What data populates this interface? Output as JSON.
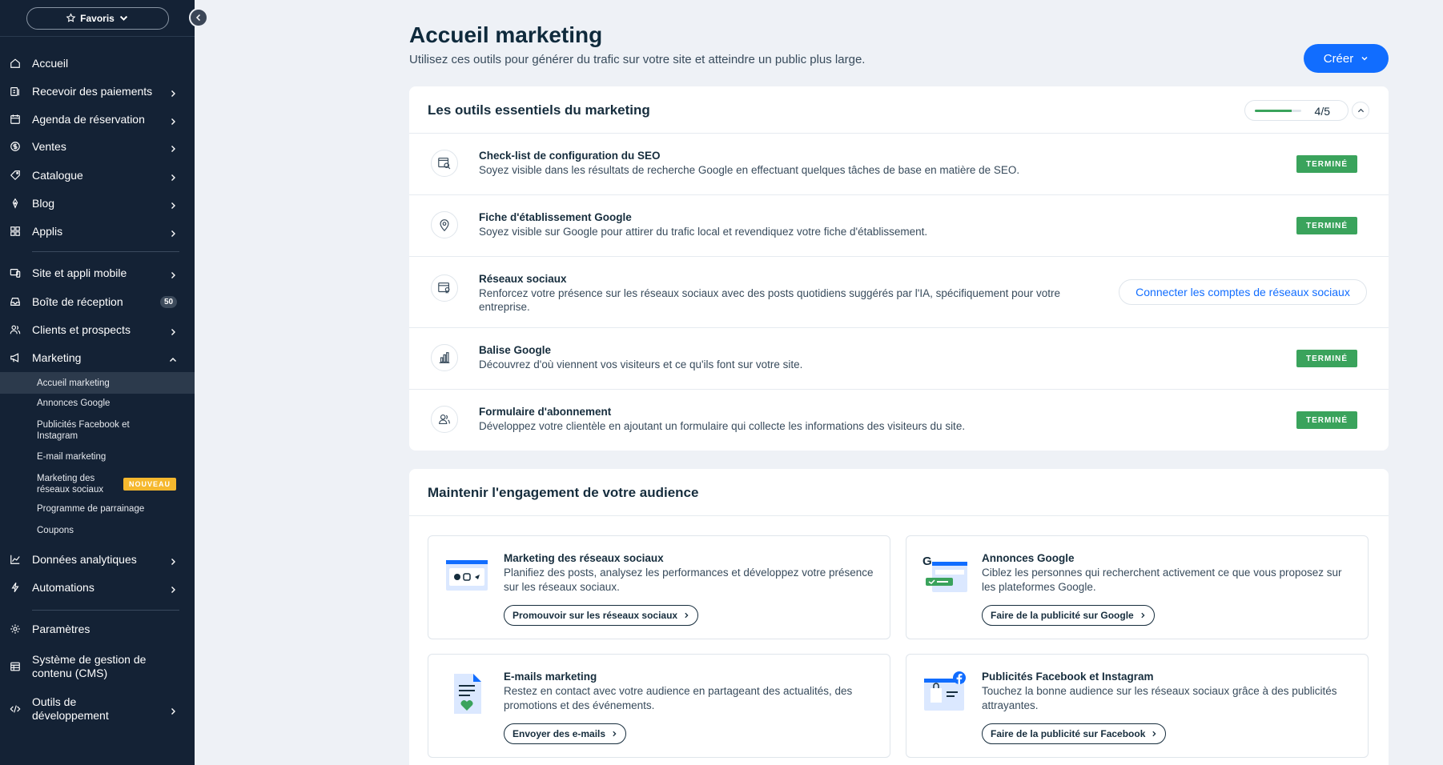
{
  "sidebar": {
    "favorites_label": "Favoris",
    "nav": [
      {
        "label": "Accueil",
        "icon": "home-icon"
      },
      {
        "label": "Recevoir des paiements",
        "icon": "payment-icon"
      },
      {
        "label": "Agenda de réservation",
        "icon": "calendar-icon"
      },
      {
        "label": "Ventes",
        "icon": "dollar-icon"
      },
      {
        "label": "Catalogue",
        "icon": "tag-icon"
      },
      {
        "label": "Blog",
        "icon": "pen-icon"
      },
      {
        "label": "Applis",
        "icon": "apps-icon"
      },
      {
        "label": "Site et appli mobile",
        "icon": "site-icon"
      },
      {
        "label": "Boîte de réception",
        "icon": "inbox-icon",
        "count": "50"
      },
      {
        "label": "Clients et prospects",
        "icon": "contacts-icon"
      },
      {
        "label": "Marketing",
        "icon": "megaphone-icon"
      },
      {
        "label": "Données analytiques",
        "icon": "analytics-icon"
      },
      {
        "label": "Automations",
        "icon": "automation-icon"
      },
      {
        "label": "Paramètres",
        "icon": "gear-icon"
      },
      {
        "label": "Système de gestion de contenu (CMS)",
        "icon": "cms-icon"
      },
      {
        "label": "Outils de développement",
        "icon": "code-icon"
      }
    ],
    "marketing_sub": [
      {
        "label": "Accueil marketing",
        "active": true
      },
      {
        "label": "Annonces Google"
      },
      {
        "label": "Publicités Facebook et Instagram"
      },
      {
        "label": "E-mail marketing"
      },
      {
        "label": "Marketing des réseaux sociaux",
        "badge": "NOUVEAU"
      },
      {
        "label": "Programme de parrainage"
      },
      {
        "label": "Coupons"
      }
    ]
  },
  "header": {
    "title": "Accueil marketing",
    "subtitle": "Utilisez ces outils pour générer du trafic sur votre site et atteindre un public plus large.",
    "create_label": "Créer"
  },
  "essentials": {
    "title": "Les outils essentiels du marketing",
    "progress_text": "4/5",
    "progress_fraction": 0.8,
    "rows": [
      {
        "title": "Check-list de configuration du SEO",
        "desc": "Soyez visible dans les résultats de recherche Google en effectuant quelques tâches de base en matière de SEO.",
        "status": "TERMINÉ",
        "icon": "seo-search-icon"
      },
      {
        "title": "Fiche d'établissement Google",
        "desc": "Soyez visible sur Google pour attirer du trafic local et revendiquez votre fiche d'établissement.",
        "status": "TERMINÉ",
        "icon": "location-pin-icon"
      },
      {
        "title": "Réseaux sociaux",
        "desc": "Renforcez votre présence sur les réseaux sociaux avec des posts quotidiens suggérés par l'IA, spécifiquement pour votre entreprise.",
        "action": "Connecter les comptes de réseaux sociaux",
        "icon": "social-post-icon"
      },
      {
        "title": "Balise Google",
        "desc": "Découvrez d'où viennent vos visiteurs et ce qu'ils font sur votre site.",
        "status": "TERMINÉ",
        "icon": "bar-chart-icon"
      },
      {
        "title": "Formulaire d'abonnement",
        "desc": "Développez votre clientèle en ajoutant un formulaire qui collecte les informations des visiteurs du site.",
        "status": "TERMINÉ",
        "icon": "subscribers-icon"
      }
    ]
  },
  "engagement": {
    "title": "Maintenir l'engagement de votre audience",
    "tiles": [
      {
        "title": "Marketing des réseaux sociaux",
        "desc": "Planifiez des posts, analysez les performances et développez votre présence sur les réseaux sociaux.",
        "button": "Promouvoir sur les réseaux sociaux",
        "icon": "social-marketing-illustration"
      },
      {
        "title": "Annonces Google",
        "desc": "Ciblez les personnes qui recherchent activement ce que vous proposez sur les plateformes Google.",
        "button": "Faire de la publicité sur Google",
        "icon": "google-ads-illustration"
      },
      {
        "title": "E-mails marketing",
        "desc": "Restez en contact avec votre audience en partageant des actualités, des promotions et des événements.",
        "button": "Envoyer des e-mails",
        "icon": "email-illustration"
      },
      {
        "title": "Publicités Facebook et Instagram",
        "desc": "Touchez la bonne audience sur les réseaux sociaux grâce à des publicités attrayantes.",
        "button": "Faire de la publicité sur Facebook",
        "icon": "facebook-ads-illustration"
      }
    ]
  },
  "colors": {
    "accent": "#116dff",
    "success": "#3aa35c",
    "sidebar_bg": "#142235",
    "badge_new": "#f5b82e"
  }
}
